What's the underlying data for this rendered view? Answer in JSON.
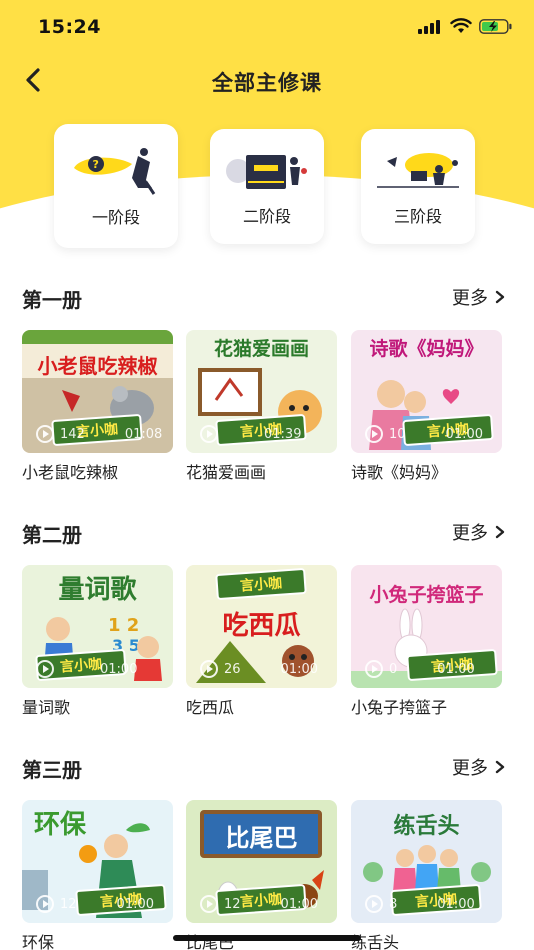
{
  "status": {
    "time": "15:24"
  },
  "header": {
    "title": "全部主修课"
  },
  "stages": [
    {
      "label": "一阶段"
    },
    {
      "label": "二阶段"
    },
    {
      "label": "三阶段"
    }
  ],
  "sections": [
    {
      "title": "第一册",
      "more": "更多",
      "items": [
        {
          "label": "小老鼠吃辣椒",
          "thumb_title": "小老鼠吃辣椒",
          "plays": "142",
          "duration": "01:08",
          "colors": {
            "bg": "#f4ecd8",
            "title": "#d81e1e"
          }
        },
        {
          "label": "花猫爱画画",
          "thumb_title": "花猫爱画画",
          "plays": "",
          "duration": "01:39",
          "colors": {
            "bg": "#eef4e2",
            "title": "#2b7a2b"
          }
        },
        {
          "label": "诗歌《妈妈》",
          "thumb_title": "诗歌《妈妈》",
          "plays": "10",
          "duration": "01:00",
          "colors": {
            "bg": "#f6e6f0",
            "title": "#c0187a"
          }
        }
      ]
    },
    {
      "title": "第二册",
      "more": "更多",
      "items": [
        {
          "label": "量词歌",
          "thumb_title": "量词歌",
          "plays": "",
          "duration": "01:00",
          "colors": {
            "bg": "#eaf3dc",
            "title": "#2f7d2f"
          }
        },
        {
          "label": "吃西瓜",
          "thumb_title": "吃西瓜",
          "plays": "26",
          "duration": "01:00",
          "colors": {
            "bg": "#f2f3d8",
            "title": "#d81e1e"
          }
        },
        {
          "label": "小兔子挎篮子",
          "thumb_title": "小兔子挎篮子",
          "plays": "0",
          "duration": "01:00",
          "colors": {
            "bg": "#f8e4ee",
            "title": "#d0287a"
          }
        }
      ]
    },
    {
      "title": "第三册",
      "more": "更多",
      "items": [
        {
          "label": "环保",
          "thumb_title": "环保",
          "plays": "12",
          "duration": "01:00",
          "colors": {
            "bg": "#e6f3f8",
            "title": "#3a9a2f"
          }
        },
        {
          "label": "比尾巴",
          "thumb_title": "比尾巴",
          "plays": "12",
          "duration": "01:00",
          "colors": {
            "bg": "#dcecc4",
            "title": "#2a5fa8"
          }
        },
        {
          "label": "练舌头",
          "thumb_title": "练舌头",
          "plays": "8",
          "duration": "01:00",
          "colors": {
            "bg": "#e4ecf6",
            "title": "#2a7a3a"
          }
        }
      ]
    }
  ],
  "brand": {
    "yellow": "#FFE045",
    "badge_text": "言小咖"
  },
  "icons": {
    "back": "chevron-left-icon",
    "more": "chevron-right-icon",
    "play": "play-icon"
  }
}
